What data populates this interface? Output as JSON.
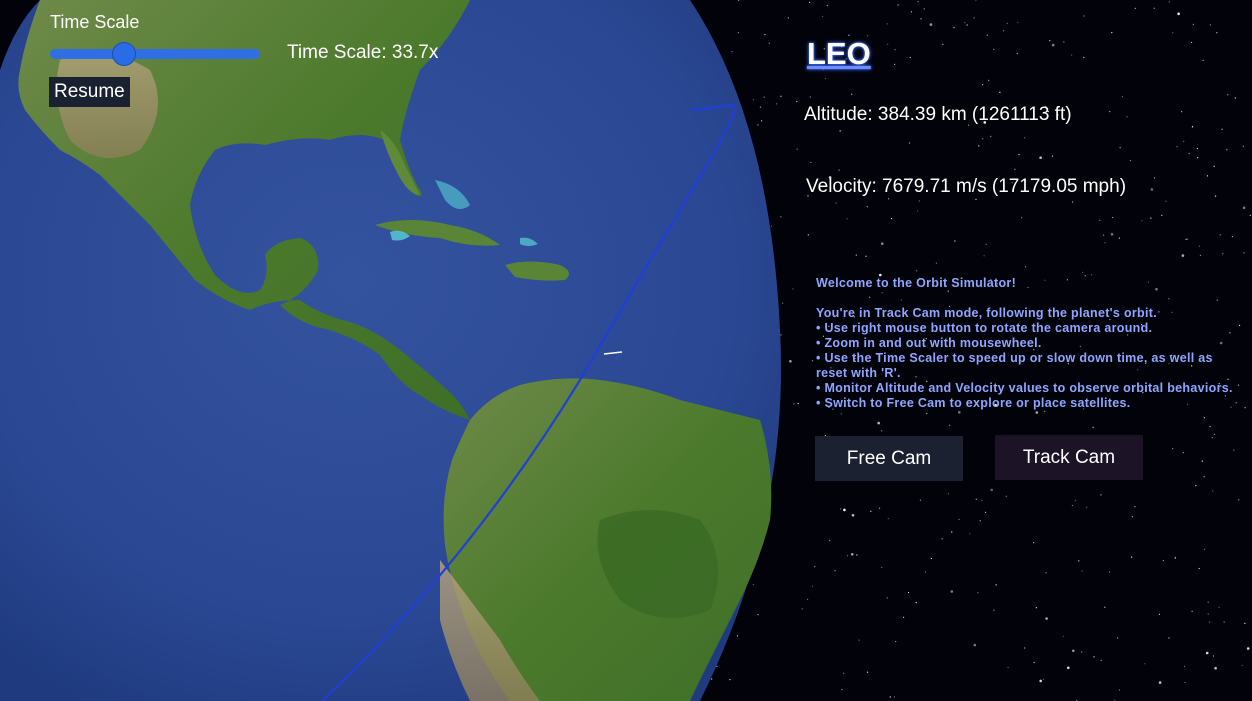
{
  "time_scale": {
    "title": "Time Scale",
    "value_label": "Time Scale: 33.7x",
    "slider_fraction": 0.35,
    "pause_label": "Resume"
  },
  "orbit": {
    "name": "LEO",
    "altitude": "Altitude: 384.39 km (1261113 ft)",
    "velocity": "Velocity: 7679.71 m/s (17179.05 mph)"
  },
  "help": {
    "lines": [
      "Welcome to the Orbit Simulator!",
      "",
      "You're in Track Cam mode, following the planet's orbit.",
      "• Use right mouse button to rotate the camera around.",
      "• Zoom in and out with mousewheel.",
      "• Use the Time Scaler to speed up or slow down time, as well as reset with 'R'.",
      "• Monitor Altitude and Velocity values to observe orbital behaviors.",
      "• Switch to Free Cam to explore or place satellites."
    ]
  },
  "camera_buttons": {
    "free": "Free Cam",
    "track": "Track Cam"
  },
  "colors": {
    "orbit_line": "#1f3fd6",
    "ocean": "#2c4a9e",
    "land": "#4f7a2e",
    "help_text": "#8fa6ff"
  }
}
